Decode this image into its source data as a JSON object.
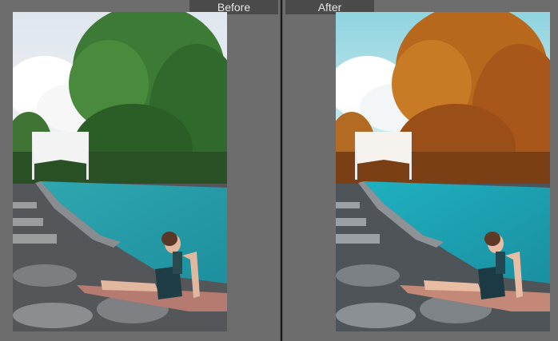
{
  "labels": {
    "before": "Before",
    "after": "After"
  },
  "panes": [
    {
      "id": "before",
      "style": "original"
    },
    {
      "id": "after",
      "style": "warm-teal-edit"
    }
  ],
  "colors": {
    "background": "#6d6d6d",
    "label_bg": "#4a4a4a",
    "label_text": "#e6e6e6",
    "divider": "#1b1b1b",
    "before_foliage": "#2f6a2c",
    "after_foliage": "#b86a1e",
    "pool_water": "#1fa6b4"
  }
}
